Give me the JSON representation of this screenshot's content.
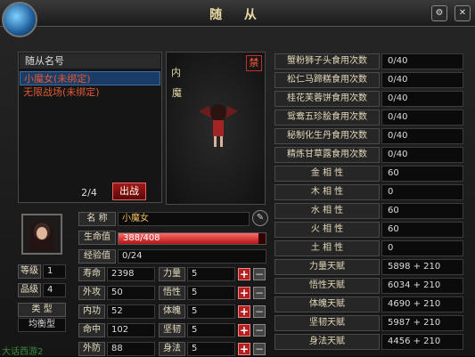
{
  "window": {
    "title": "随 从"
  },
  "list": {
    "header": "随从名号",
    "items": [
      {
        "label": "小魔女(未绑定)"
      },
      {
        "label": "无限战场(未绑定)"
      }
    ],
    "page": "2/4",
    "deploy_label": "出战"
  },
  "preview": {
    "label": "内",
    "name": "魔",
    "seal": "禁"
  },
  "info": {
    "name_label": "名 称",
    "name_value": "小魔女",
    "hp_label": "生命值",
    "hp_value": "388/408",
    "hp_fraction": 0.951,
    "exp_label": "经验值",
    "exp_value": "0/24",
    "level_label": "等级",
    "level_value": "1",
    "grade_label": "品级",
    "grade_value": "4",
    "type_label": "类 型",
    "type_value": "均衡型"
  },
  "stats_left": [
    {
      "label": "寿命",
      "value": "2398"
    },
    {
      "label": "外攻",
      "value": "50"
    },
    {
      "label": "内功",
      "value": "52"
    },
    {
      "label": "命中",
      "value": "102"
    },
    {
      "label": "外防",
      "value": "88"
    }
  ],
  "stats_mid": [
    {
      "label": "力量",
      "value": "5"
    },
    {
      "label": "悟性",
      "value": "5"
    },
    {
      "label": "体魄",
      "value": "5"
    },
    {
      "label": "坚韧",
      "value": "5"
    },
    {
      "label": "身法",
      "value": "5"
    }
  ],
  "right_rows": [
    {
      "label": "蟹粉狮子头食用次数",
      "value": "0/40"
    },
    {
      "label": "松仁马蹄糕食用次数",
      "value": "0/40"
    },
    {
      "label": "桂花芙蓉饼食用次数",
      "value": "0/40"
    },
    {
      "label": "鸳鸯五珍脍食用次数",
      "value": "0/40"
    },
    {
      "label": "秘制化生丹食用次数",
      "value": "0/40"
    },
    {
      "label": "精炼甘草露食用次数",
      "value": "0/40"
    },
    {
      "label": "金 相 性",
      "value": "60"
    },
    {
      "label": "木 相 性",
      "value": "0"
    },
    {
      "label": "水 相 性",
      "value": "60"
    },
    {
      "label": "火 相 性",
      "value": "60"
    },
    {
      "label": "土 相 性",
      "value": "0"
    },
    {
      "label": "力量天赋",
      "value": "5898 + 210"
    },
    {
      "label": "悟性天赋",
      "value": "6034 + 210"
    },
    {
      "label": "体魄天赋",
      "value": "4690 + 210"
    },
    {
      "label": "坚韧天赋",
      "value": "5987 + 210"
    },
    {
      "label": "身法天赋",
      "value": "4456 + 210"
    }
  ],
  "watermark": "大话西游2"
}
